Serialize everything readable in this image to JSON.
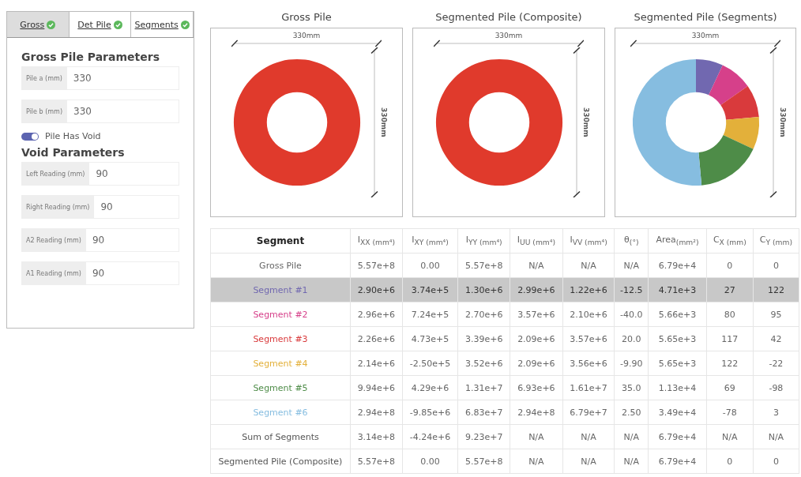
{
  "tabs": [
    {
      "label": "Gross",
      "selected": true,
      "complete": true
    },
    {
      "label": "Det Pile",
      "selected": false,
      "complete": true
    },
    {
      "label": "Segments",
      "selected": false,
      "complete": true
    }
  ],
  "gross_parameters": {
    "title": "Gross Pile Parameters",
    "fields": [
      {
        "label": "Pile a (mm)",
        "value": "330"
      },
      {
        "label": "Pile b (mm)",
        "value": "330"
      }
    ]
  },
  "void_toggle": {
    "label": "Pile Has Void",
    "on": true
  },
  "void_parameters": {
    "title": "Void Parameters",
    "fields": [
      {
        "label": "Left Reading (mm)",
        "value": "90"
      },
      {
        "label": "Right Reading (mm)",
        "value": "90"
      },
      {
        "label": "A2 Reading (mm)",
        "value": "90"
      },
      {
        "label": "A1 Reading (mm)",
        "value": "90"
      }
    ]
  },
  "views": [
    {
      "title": "Gross Pile",
      "kind": "solid",
      "width_label": "330mm",
      "height_label": "330mm"
    },
    {
      "title": "Segmented Pile (Composite)",
      "kind": "solid",
      "width_label": "330mm",
      "height_label": "330mm"
    },
    {
      "title": "Segmented Pile (Segments)",
      "kind": "segments",
      "width_label": "330mm",
      "height_label": "330mm"
    }
  ],
  "table": {
    "columns": [
      "Segment",
      "I$_{XX (mm⁴)}$",
      "I$_{XY (mm⁴)}$",
      "I$_{YY (mm⁴)}$",
      "I$_{UU (mm⁴)}$",
      "I$_{VV (mm⁴)}$",
      "θ$_{(°)}$",
      "Area$_{(mm²)}$",
      "C$_{X (mm)}$",
      "C$_{Y (mm)}$"
    ],
    "rows": [
      {
        "kind": "gross",
        "selected": false,
        "cells": [
          "Gross Pile",
          "5.57e+8",
          "0.00",
          "5.57e+8",
          "N/A",
          "N/A",
          "N/A",
          "6.79e+4",
          "0",
          "0"
        ]
      },
      {
        "kind": "segment",
        "selected": true,
        "color": "#7168b0",
        "cells": [
          "Segment #1",
          "2.90e+6",
          "3.74e+5",
          "1.30e+6",
          "2.99e+6",
          "1.22e+6",
          "-12.5",
          "4.71e+3",
          "27",
          "122"
        ]
      },
      {
        "kind": "segment",
        "selected": false,
        "color": "#d6408a",
        "cells": [
          "Segment #2",
          "2.96e+6",
          "7.24e+5",
          "2.70e+6",
          "3.57e+6",
          "2.10e+6",
          "-40.0",
          "5.66e+3",
          "80",
          "95"
        ]
      },
      {
        "kind": "segment",
        "selected": false,
        "color": "#d93a3c",
        "cells": [
          "Segment #3",
          "2.26e+6",
          "4.73e+5",
          "3.39e+6",
          "2.09e+6",
          "3.57e+6",
          "20.0",
          "5.65e+3",
          "117",
          "42"
        ]
      },
      {
        "kind": "segment",
        "selected": false,
        "color": "#e3b03a",
        "cells": [
          "Segment #4",
          "2.14e+6",
          "-2.50e+5",
          "3.52e+6",
          "2.09e+6",
          "3.56e+6",
          "-9.90",
          "5.65e+3",
          "122",
          "-22"
        ]
      },
      {
        "kind": "segment",
        "selected": false,
        "color": "#4e8c48",
        "cells": [
          "Segment #5",
          "9.94e+6",
          "4.29e+6",
          "1.31e+7",
          "6.93e+6",
          "1.61e+7",
          "35.0",
          "1.13e+4",
          "69",
          "-98"
        ]
      },
      {
        "kind": "segment",
        "selected": false,
        "color": "#86bde0",
        "cells": [
          "Segment #6",
          "2.94e+8",
          "-9.85e+6",
          "6.83e+7",
          "2.94e+8",
          "6.79e+7",
          "2.50",
          "3.49e+4",
          "-78",
          "3"
        ]
      },
      {
        "kind": "sum",
        "selected": false,
        "cells": [
          "Sum of Segments",
          "3.14e+8",
          "-4.24e+6",
          "9.23e+7",
          "N/A",
          "N/A",
          "N/A",
          "6.79e+4",
          "N/A",
          "N/A"
        ]
      },
      {
        "kind": "composite",
        "selected": false,
        "cells": [
          "Segmented Pile (Composite)",
          "5.57e+8",
          "0.00",
          "5.57e+8",
          "N/A",
          "N/A",
          "N/A",
          "6.79e+4",
          "0",
          "0"
        ]
      }
    ]
  }
}
